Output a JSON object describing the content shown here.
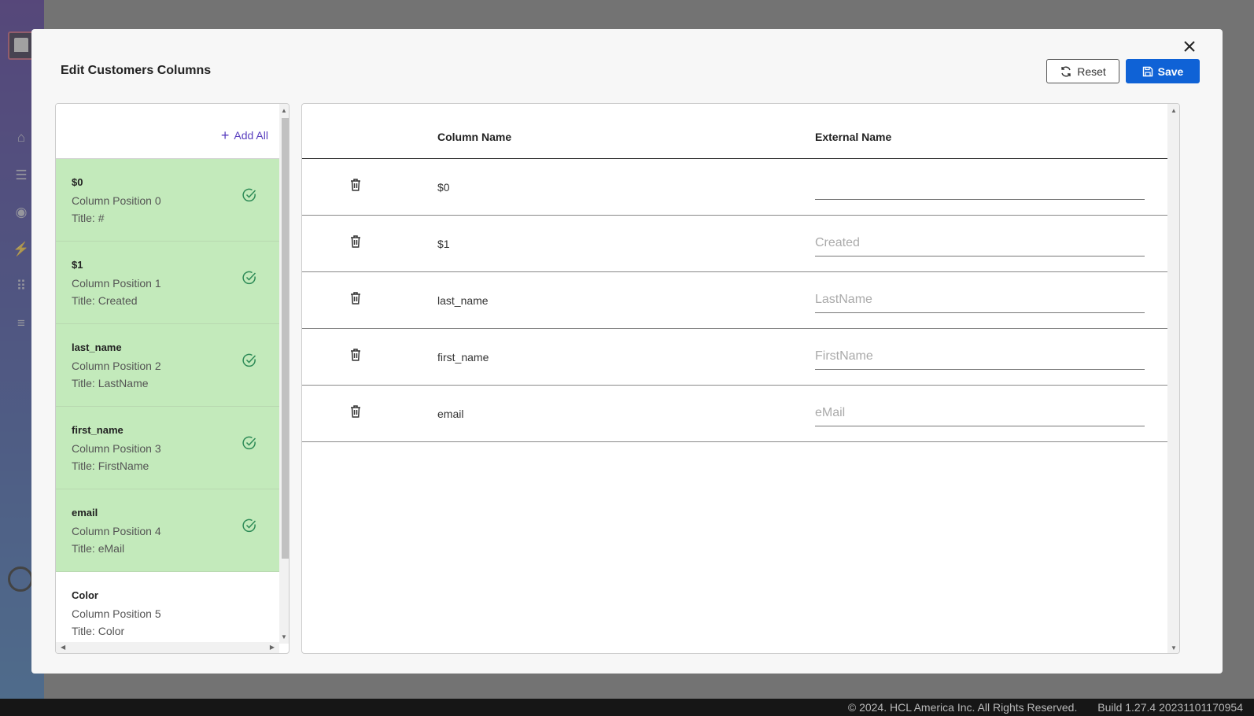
{
  "modal": {
    "title": "Edit Customers Columns",
    "reset_label": "Reset",
    "save_label": "Save"
  },
  "left_panel": {
    "add_all_label": "Add All",
    "items": [
      {
        "name": "$0",
        "position": "Column Position 0",
        "title": "Title: #",
        "selected": true
      },
      {
        "name": "$1",
        "position": "Column Position 1",
        "title": "Title: Created",
        "selected": true
      },
      {
        "name": "last_name",
        "position": "Column Position 2",
        "title": "Title: LastName",
        "selected": true
      },
      {
        "name": "first_name",
        "position": "Column Position 3",
        "title": "Title: FirstName",
        "selected": true
      },
      {
        "name": "email",
        "position": "Column Position 4",
        "title": "Title: eMail",
        "selected": true
      },
      {
        "name": "Color",
        "position": "Column Position 5",
        "title": "Title: Color",
        "selected": false
      }
    ]
  },
  "table": {
    "headers": {
      "column_name": "Column Name",
      "external_name": "External Name"
    },
    "rows": [
      {
        "column": "$0",
        "external_value": "",
        "external_placeholder": ""
      },
      {
        "column": "$1",
        "external_value": "",
        "external_placeholder": "Created"
      },
      {
        "column": "last_name",
        "external_value": "",
        "external_placeholder": "LastName"
      },
      {
        "column": "first_name",
        "external_value": "",
        "external_placeholder": "FirstName"
      },
      {
        "column": "email",
        "external_value": "",
        "external_placeholder": "eMail"
      }
    ]
  },
  "footer": {
    "copyright": "© 2024. HCL America Inc. All Rights Reserved.",
    "build": "Build 1.27.4 20231101170954"
  },
  "colors": {
    "accent": "#0f62d6",
    "selected_item": "#c3eabb",
    "add_all": "#5a3fbf",
    "check": "#2e8b57"
  }
}
